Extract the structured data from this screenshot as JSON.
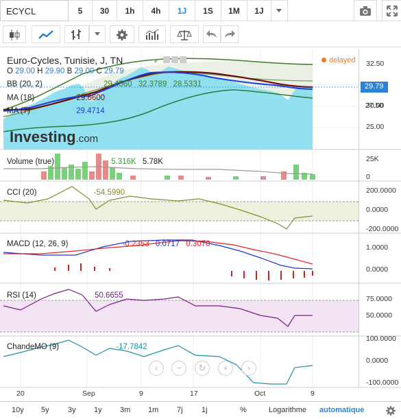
{
  "topbar": {
    "symbol": "ECYCL",
    "timeframes": [
      "5",
      "30",
      "1h",
      "4h",
      "1J",
      "1S",
      "1M",
      "1J"
    ],
    "active_timeframe": "1J",
    "camera_icon": "camera-icon",
    "fullscreen_icon": "fullscreen-icon"
  },
  "toolbar": {
    "items": [
      "candles-icon",
      "area-chart-icon",
      "bars-icon",
      "settings-icon",
      "indicators-icon",
      "balance-icon",
      "undo-icon",
      "redo-icon"
    ]
  },
  "price_pane": {
    "title": "Euro-Cycles, Tunisie, J, TN",
    "delayed": "delayed",
    "ohlc": {
      "o_label": "O",
      "o": "29.00",
      "h_label": "H",
      "h": "29.90",
      "b_label": "B",
      "b": "29.00",
      "c_label": "C",
      "c": "29.79"
    },
    "bb_label": "BB (20, 2)",
    "bb_values": [
      "29.4560",
      "32.3789",
      "28.5331"
    ],
    "ma18_label": "MA (18)",
    "ma18_value": "29.6600",
    "ma7_label": "MA (7)",
    "ma7_value": "29.4714",
    "current_price": "29.79",
    "ticks": [
      "32.50",
      "30.00",
      "27.50",
      "25.00"
    ],
    "watermark": "Investing",
    "watermark_suffix": ".com"
  },
  "volume_pane": {
    "label": "Volume (true)",
    "values": [
      "5.316K",
      "5.78K"
    ],
    "ticks": [
      "25K",
      "0"
    ]
  },
  "cci_pane": {
    "label": "CCI (20)",
    "value": "-54.5990",
    "ticks": [
      "200.0000",
      "0.0000",
      "-200.0000"
    ]
  },
  "macd_pane": {
    "label": "MACD (12, 26, 9)",
    "values": [
      "-0.2353",
      "0.0717",
      "0.3070"
    ],
    "ticks": [
      "1.0000",
      "0.0000"
    ]
  },
  "rsi_pane": {
    "label": "RSI (14)",
    "value": "50.6655",
    "ticks": [
      "75.0000",
      "50.0000"
    ]
  },
  "chandemo_pane": {
    "label": "ChandeMO (9)",
    "value": "-17.7842",
    "ticks": [
      "100.0000",
      "0.0000",
      "-100.0000"
    ]
  },
  "xaxis": {
    "labels": [
      "20",
      "Sep",
      "9",
      "17",
      "Oct",
      "9"
    ]
  },
  "bottombar": {
    "ranges": [
      "10y",
      "5y",
      "3y",
      "1y",
      "3m",
      "1m",
      "7j",
      "1j"
    ],
    "percent": "%",
    "log": "Logarithme",
    "auto": "automatique"
  },
  "colors": {
    "accent": "#2a83d6",
    "area_fill": "#7fdcef",
    "bb_green": "#3c7d22",
    "ma_red": "#6b0f0f",
    "ma_blue": "#1f3fd6",
    "cci": "#8a8a2a",
    "macd_blue": "#2233cc",
    "macd_red": "#dd2222",
    "rsi": "#7a1a8a",
    "chande": "#1e8fa0",
    "delayed": "#f07a1a"
  }
}
